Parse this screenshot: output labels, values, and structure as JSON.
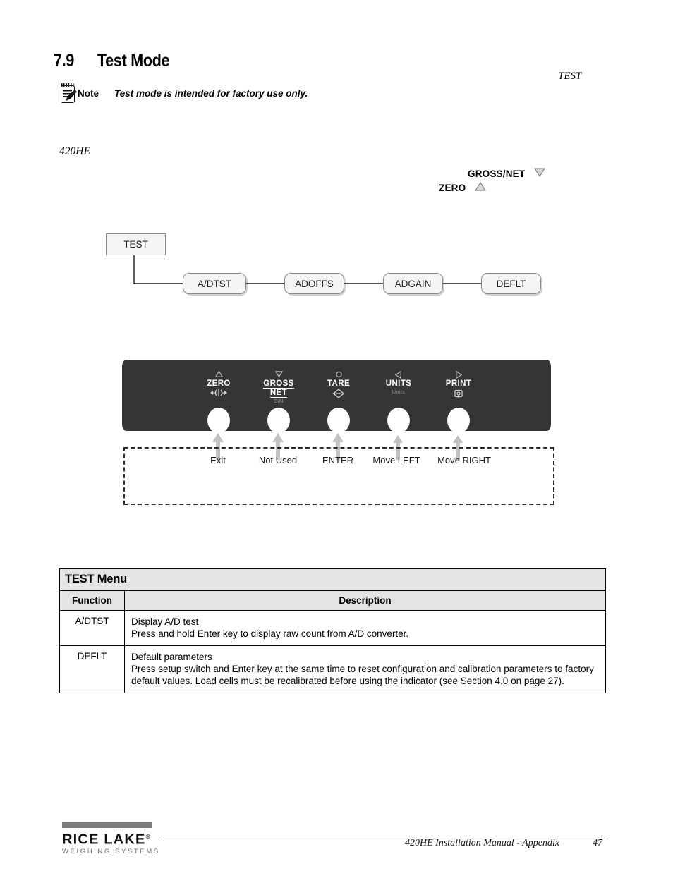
{
  "section": {
    "number": "7.9",
    "title": "Test Mode"
  },
  "note": {
    "icon": "notepad-pencil-icon",
    "label": "Note",
    "text": "Test mode is intended for factory use only."
  },
  "labels": {
    "menu_name_italic": "TEST",
    "model_italic": "420HE"
  },
  "key_hints": [
    {
      "name": "GROSS/NET",
      "arrow": "triangle-down"
    },
    {
      "name": "ZERO",
      "arrow": "triangle-up"
    }
  ],
  "flowchart": {
    "root": "TEST",
    "nodes": [
      "A/DTST",
      "ADOFFS",
      "ADGAIN",
      "DEFLT"
    ]
  },
  "keypad": {
    "keys": [
      {
        "glyph_top": "triangle-up",
        "name": "ZERO",
        "name2": "",
        "sub_text": "",
        "sub_symbol": "zero-center-icon"
      },
      {
        "glyph_top": "triangle-down",
        "name": "GROSS",
        "name2": "NET",
        "sub_text": "B/N",
        "sub_symbol": ""
      },
      {
        "glyph_top": "circle",
        "name": "TARE",
        "name2": "",
        "sub_text": "",
        "sub_symbol": "tare-diamond-icon"
      },
      {
        "glyph_top": "triangle-left",
        "name": "UNITS",
        "name2": "",
        "sub_text": "Units",
        "sub_symbol": ""
      },
      {
        "glyph_top": "triangle-right",
        "name": "PRINT",
        "name2": "",
        "sub_text": "",
        "sub_symbol": "print-icon"
      }
    ],
    "callouts": [
      "Exit",
      "Not Used",
      "ENTER",
      "Move LEFT",
      "Move RIGHT"
    ]
  },
  "table": {
    "title": "TEST Menu",
    "columns": [
      "Function",
      "Description"
    ],
    "rows": [
      {
        "function": "A/DTST",
        "description_line1": "Display A/D test",
        "description_line2": "Press and hold Enter key to display raw count from A/D converter.",
        "description_line3": ""
      },
      {
        "function": "DEFLT",
        "description_line1": "Default parameters",
        "description_line2": "Press setup switch and Enter key at the same time to reset configuration and calibration parameters to factory",
        "description_line3": "default values. Load cells must be recalibrated before using the indicator (see Section 4.0 on page 27)."
      }
    ]
  },
  "footer": {
    "logo_name": "RICE LAKE",
    "logo_trademark": "®",
    "logo_sub": "WEIGHING SYSTEMS",
    "manual_text": "420HE Installation Manual - Appendix",
    "page_number": "47"
  },
  "colors": {
    "panel_bg": "#353535",
    "box_fill": "#f4f4f4",
    "box_border": "#8a8a8a",
    "table_header_bg": "#e4e4e4",
    "arrow_gray": "#c0c0c0",
    "logo_bar": "#7d7d7d"
  }
}
